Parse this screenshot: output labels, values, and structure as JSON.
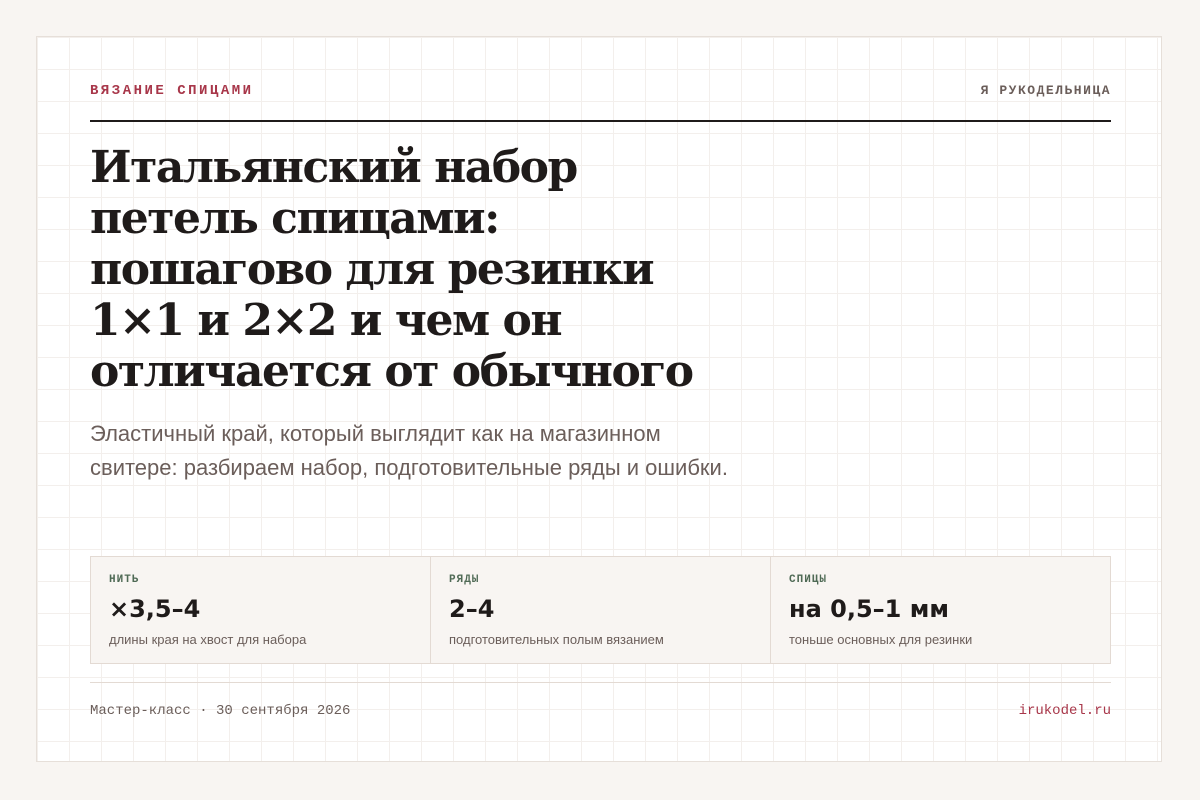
{
  "header": {
    "category": "ВЯЗАНИЕ СПИЦАМИ",
    "brand": "Я РУКОДЕЛЬНИЦА"
  },
  "article": {
    "title": "Итальянский набор петель спицами: пошагово для резинки 1×1 и 2×2 и чем он отличается от обычного",
    "lead": "Эластичный край, который выглядит как на магазинном свитере: разбираем набор, подготовительные ряды и ошибки."
  },
  "stats": [
    {
      "label": "НИТЬ",
      "value": "×3,5–4",
      "desc": "длины края на хвост для набора"
    },
    {
      "label": "РЯДЫ",
      "value": "2–4",
      "desc": "подготовительных полым вязанием"
    },
    {
      "label": "СПИЦЫ",
      "value": "на 0,5–1 мм",
      "desc": "тоньше основных для резинки"
    }
  ],
  "footer": {
    "date": "Мастер-класс · 30 сентября 2026",
    "site": "irukodel.ru"
  },
  "colors": {
    "accent": "#a8374a",
    "stat_label": "#4f6a55",
    "text": "#1f1b1a",
    "muted": "#6b5e5a",
    "page_background": "#f8f5f2"
  }
}
